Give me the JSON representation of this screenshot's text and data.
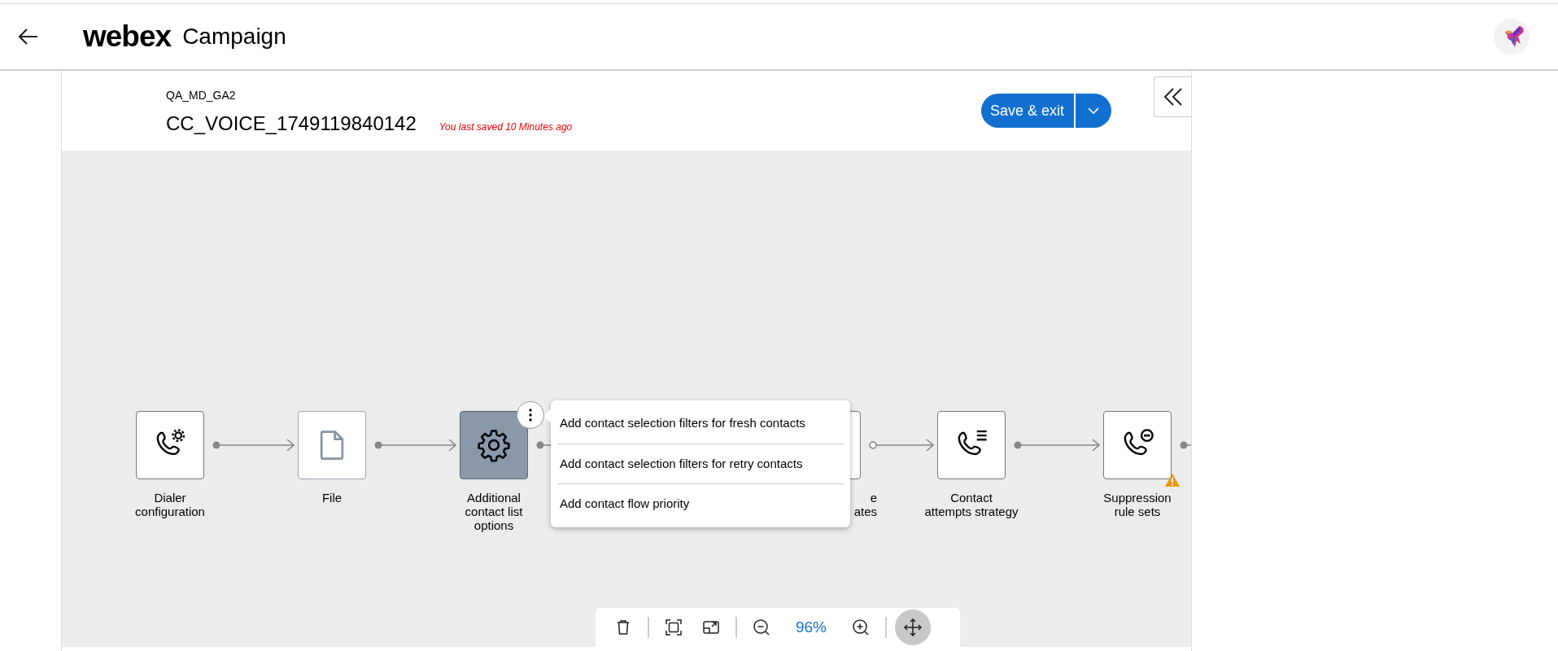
{
  "header": {
    "logo": "webex",
    "app_name": "Campaign"
  },
  "campaign": {
    "group": "QA_MD_GA2",
    "name": "CC_VOICE_1749119840142",
    "save_status": "You last saved 10 Minutes ago",
    "save_button": "Save & exit"
  },
  "nodes": [
    {
      "kind": "dialer",
      "label": "Dialer\nconfiguration",
      "selected": false,
      "warning": false
    },
    {
      "kind": "file",
      "label": "File",
      "selected": false,
      "warning": false
    },
    {
      "kind": "settings",
      "label": "Additional\ncontact list\noptions",
      "selected": true,
      "warning": false
    },
    {
      "kind": "partial",
      "label": "e\nates",
      "selected": false,
      "warning": false
    },
    {
      "kind": "attempts",
      "label": "Contact\nattempts strategy",
      "selected": false,
      "warning": false
    },
    {
      "kind": "suppression",
      "label": "Suppression\nrule sets",
      "selected": false,
      "warning": true
    }
  ],
  "connectors": [
    {
      "hollow": false
    },
    {
      "hollow": false
    },
    {
      "hollow": false
    },
    {
      "hollow": true
    },
    {
      "hollow": false
    },
    {
      "hollow": false
    }
  ],
  "node_menu": {
    "items": [
      "Add contact selection filters for fresh contacts",
      "Add contact selection filters for retry contacts",
      "Add contact flow priority"
    ]
  },
  "toolbar": {
    "zoom": "96%",
    "tools": [
      {
        "kind": "delete",
        "selected": false
      },
      {
        "kind": "fit",
        "selected": false
      },
      {
        "kind": "minimap",
        "selected": false
      },
      {
        "kind": "zoom-out",
        "selected": false
      },
      {
        "kind": "zoom-level",
        "selected": false
      },
      {
        "kind": "zoom-in",
        "selected": false
      },
      {
        "kind": "pan",
        "selected": true
      }
    ]
  }
}
